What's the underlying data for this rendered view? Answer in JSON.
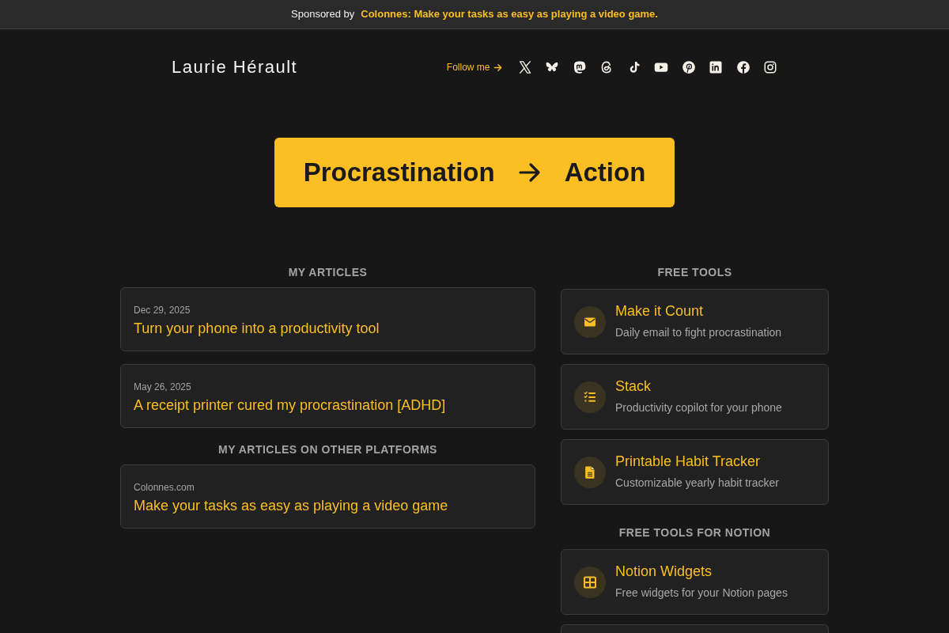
{
  "sponsor_banner": {
    "label": "Sponsored by",
    "link": "Colonnes: Make your tasks as easy as playing a video game."
  },
  "header": {
    "site_name": "Laurie Hérault",
    "follow_label": "Follow me"
  },
  "hero": {
    "left": "Procrastination",
    "right": "Action"
  },
  "articles": {
    "title": "MY ARTICLES",
    "items": [
      {
        "date": "Dec 29, 2025",
        "title": "Turn your phone into a productivity tool"
      },
      {
        "date": "May 26, 2025",
        "title": "A receipt printer cured my procrastination [ADHD]"
      }
    ]
  },
  "external_articles": {
    "title": "MY ARTICLES ON OTHER PLATFORMS",
    "items": [
      {
        "source": "Colonnes.com",
        "title": "Make your tasks as easy as playing a video game"
      }
    ]
  },
  "free_tools": {
    "title": "FREE TOOLS",
    "items": [
      {
        "name": "Make it Count",
        "description": "Daily email to fight procrastination"
      },
      {
        "name": "Stack",
        "description": "Productivity copilot for your phone"
      },
      {
        "name": "Printable Habit Tracker",
        "description": "Customizable yearly habit tracker"
      }
    ]
  },
  "notion_tools": {
    "title": "FREE TOOLS FOR NOTION",
    "items": [
      {
        "name": "Notion Widgets",
        "description": "Free widgets for your Notion pages"
      }
    ],
    "more_below": true
  }
}
